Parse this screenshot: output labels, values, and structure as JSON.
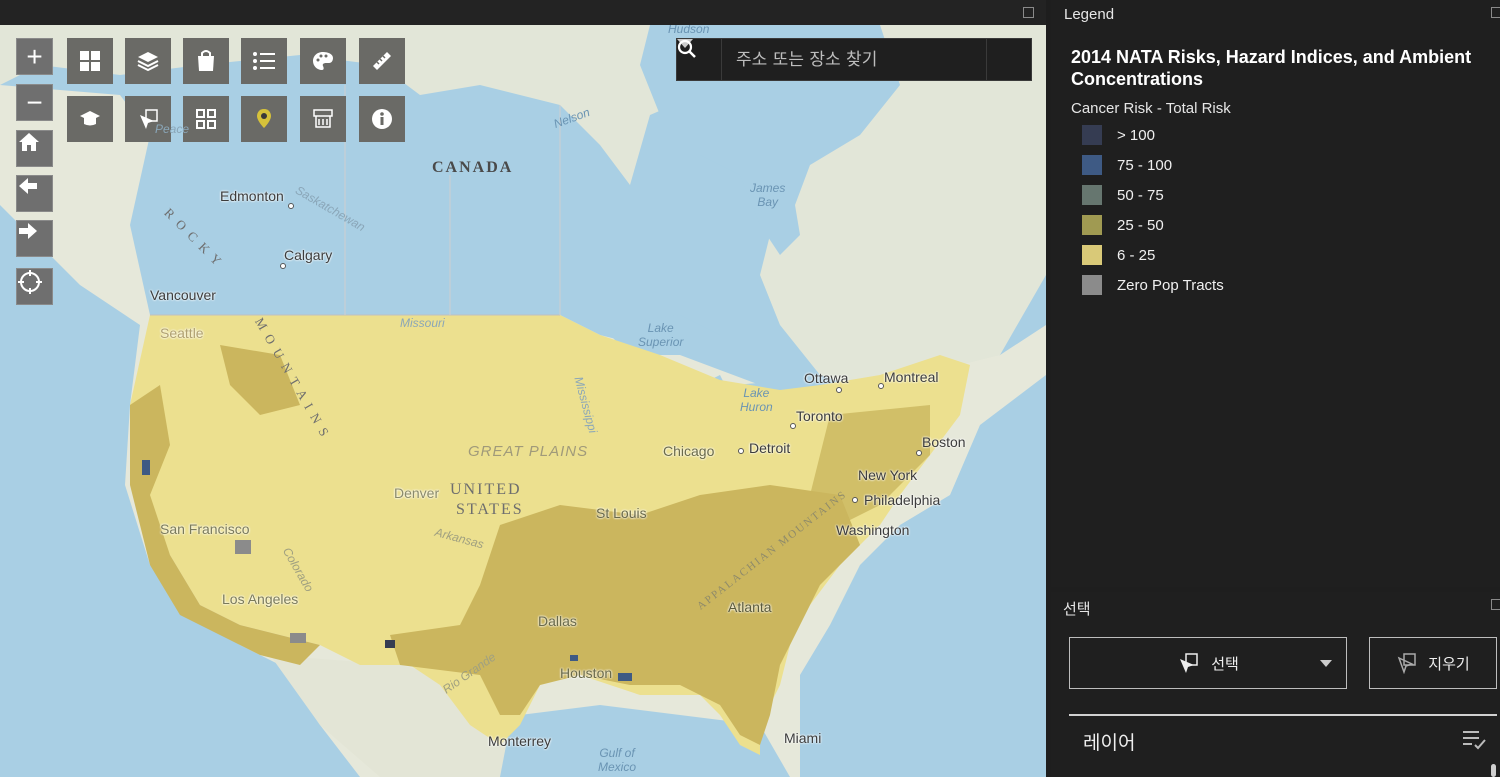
{
  "search": {
    "placeholder": "주소 또는 장소 찾기"
  },
  "map": {
    "controls": {
      "zoom_in": "+",
      "zoom_out": "−"
    },
    "labels": {
      "canada": "CANADA",
      "rocky1": "R O C K Y",
      "rocky2": "M O U N T A I N S",
      "united": "UNITED",
      "states": "STATES",
      "great_plains": "GREAT PLAINS",
      "appalachian": "APPALACHIAN MOUNTAINS",
      "edmonton": "Edmonton",
      "calgary": "Calgary",
      "vancouver": "Vancouver",
      "seattle": "Seattle",
      "san_francisco": "San Francisco",
      "los_angeles": "Los Angeles",
      "denver": "Denver",
      "dallas": "Dallas",
      "houston": "Houston",
      "st_louis": "St Louis",
      "chicago": "Chicago",
      "detroit": "Detroit",
      "toronto": "Toronto",
      "ottawa": "Ottawa",
      "montreal": "Montreal",
      "boston": "Boston",
      "new_york": "New York",
      "philadelphia": "Philadelphia",
      "washington": "Washington",
      "atlanta": "Atlanta",
      "miami": "Miami",
      "monterrey": "Monterrey",
      "hudson": "Hudson",
      "nelson": "Nelson",
      "james_bay": "James\nBay",
      "lake_superior": "Lake\nSuperior",
      "lake_huron": "Lake\nHuron",
      "gulf": "Gulf of\nMexico",
      "missouri": "Missouri",
      "mississippi": "Mississippi",
      "saskatchewan": "Saskatchewan",
      "peace": "Peace",
      "colorado": "Colorado",
      "arkansas": "Arkansas",
      "rio_grande": "Rio Grande"
    }
  },
  "legend": {
    "header": "Legend",
    "title": "2014 NATA Risks, Hazard Indices, and Ambient Concentrations",
    "subtitle": "Cancer Risk - Total Risk",
    "items": [
      {
        "label": "> 100",
        "color": "#353c52"
      },
      {
        "label": "75 - 100",
        "color": "#3e5a84"
      },
      {
        "label": "50 - 75",
        "color": "#66766f"
      },
      {
        "label": "25 - 50",
        "color": "#a09a52"
      },
      {
        "label": "6 - 25",
        "color": "#d9c978"
      },
      {
        "label": "Zero Pop Tracts",
        "color": "#8b8b8b"
      }
    ]
  },
  "selection": {
    "header": "선택",
    "select_label": "선택",
    "clear_label": "지우기",
    "layers_label": "레이어"
  }
}
